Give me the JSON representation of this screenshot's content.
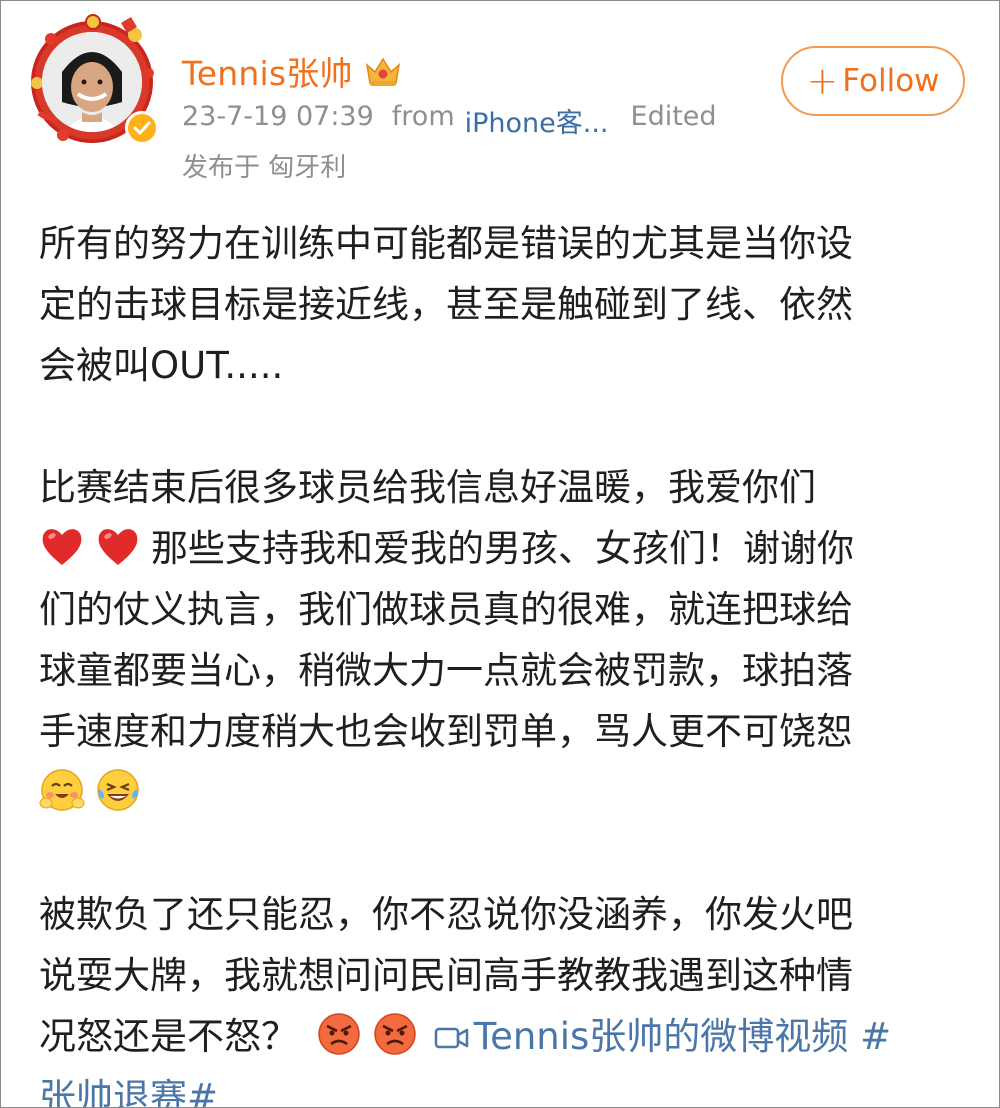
{
  "header": {
    "username": "Tennis张帅",
    "timestamp": "23-7-19 07:39",
    "from_label": "from",
    "device": "iPhone客...",
    "edited": "Edited",
    "location": "发布于 匈牙利",
    "follow_label": "Follow",
    "follow_plus": "+"
  },
  "post": {
    "para1": [
      "所有的努力在训练中可能都是错误的尤其是当你设",
      "定的击球目标是接近线，甚至是触碰到了线、依然",
      "会被叫OUT....."
    ],
    "para2": [
      "比赛结束后很多球员给我信息好温暖，我爱你们",
      "那些支持我和爱我的男孩、女孩们！谢谢你",
      "们的仗义执言，我们做球员真的很难，就连把球给",
      "球童都要当心，稍微大力一点就会被罚款，球拍落",
      "手速度和力度稍大也会收到罚单，骂人更不可饶恕"
    ],
    "para3": [
      "被欺负了还只能忍，你不忍说你没涵养，你发火吧",
      "说耍大牌，我就想问问民间高手教教我遇到这种情",
      "况怒还是不怒？"
    ],
    "video_link": "Tennis张帅的微博视频",
    "hashtag_start": "#",
    "hashtag_end": "张帅退赛#"
  },
  "colors": {
    "username": "#f0701b",
    "link": "#4a76a8",
    "meta": "#8f8f8f",
    "follow_border": "#f49a4e"
  },
  "icons": {
    "verified": "verified-badge-icon",
    "vip": "crown-icon",
    "heart": "red-heart-emoji",
    "blush": "blush-emoji",
    "laugh": "laughing-tears-emoji",
    "angry": "angry-face-emoji",
    "video": "video-camera-icon"
  }
}
